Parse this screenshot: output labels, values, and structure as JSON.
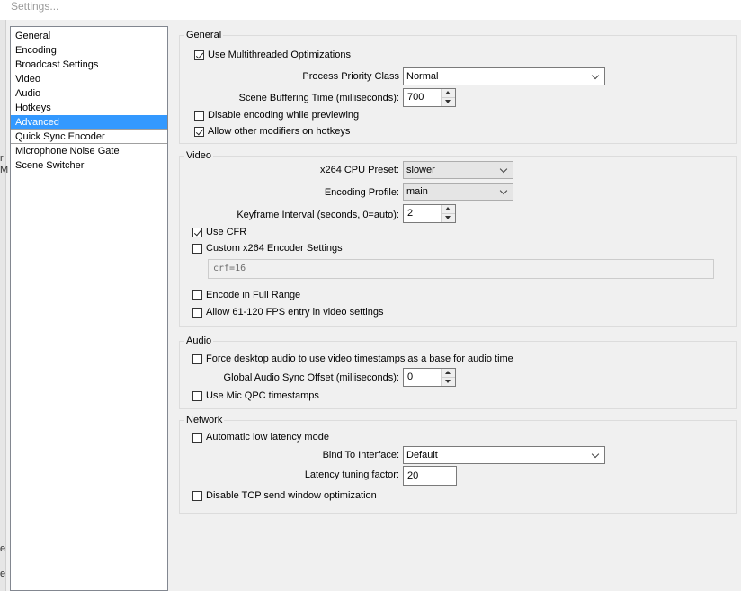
{
  "window": {
    "title": "Settings..."
  },
  "edge_glyphs": [
    "r",
    "M",
    "e",
    "e"
  ],
  "sidebar": {
    "items": [
      {
        "label": "General",
        "selected": false
      },
      {
        "label": "Encoding",
        "selected": false
      },
      {
        "label": "Broadcast Settings",
        "selected": false
      },
      {
        "label": "Video",
        "selected": false
      },
      {
        "label": "Audio",
        "selected": false
      },
      {
        "label": "Hotkeys",
        "selected": false
      },
      {
        "label": "Advanced",
        "selected": true
      },
      {
        "label": "Quick Sync Encoder",
        "selected": false
      },
      {
        "label": "Microphone Noise Gate",
        "selected": false
      },
      {
        "label": "Scene Switcher",
        "selected": false
      }
    ]
  },
  "general": {
    "title": "General",
    "multithreaded": {
      "label": "Use Multithreaded Optimizations",
      "checked": true
    },
    "priority": {
      "label": "Process Priority Class",
      "value": "Normal"
    },
    "buffering": {
      "label": "Scene Buffering Time (milliseconds):",
      "value": "700"
    },
    "disable_preview": {
      "label": "Disable encoding while previewing",
      "checked": false
    },
    "modifiers": {
      "label": "Allow other modifiers on hotkeys",
      "checked": true
    }
  },
  "video": {
    "title": "Video",
    "preset": {
      "label": "x264 CPU Preset:",
      "value": "slower"
    },
    "profile": {
      "label": "Encoding Profile:",
      "value": "main"
    },
    "keyframe": {
      "label": "Keyframe Interval (seconds, 0=auto):",
      "value": "2"
    },
    "cfr": {
      "label": "Use CFR",
      "checked": true
    },
    "custom": {
      "label": "Custom x264 Encoder Settings",
      "checked": false,
      "value": "crf=16"
    },
    "full_range": {
      "label": "Encode in Full Range",
      "checked": false
    },
    "fps": {
      "label": "Allow 61-120 FPS entry in video settings",
      "checked": false
    }
  },
  "audio": {
    "title": "Audio",
    "force_ts": {
      "label": "Force desktop audio to use video timestamps as a base for audio time",
      "checked": false
    },
    "sync": {
      "label": "Global Audio Sync Offset (milliseconds):",
      "value": "0"
    },
    "qpc": {
      "label": "Use Mic QPC timestamps",
      "checked": false
    }
  },
  "network": {
    "title": "Network",
    "low_latency": {
      "label": "Automatic low latency mode",
      "checked": false
    },
    "bind": {
      "label": "Bind To Interface:",
      "value": "Default"
    },
    "latency": {
      "label": "Latency tuning factor:",
      "value": "20"
    },
    "tcp": {
      "label": "Disable TCP send window optimization",
      "checked": false
    }
  }
}
